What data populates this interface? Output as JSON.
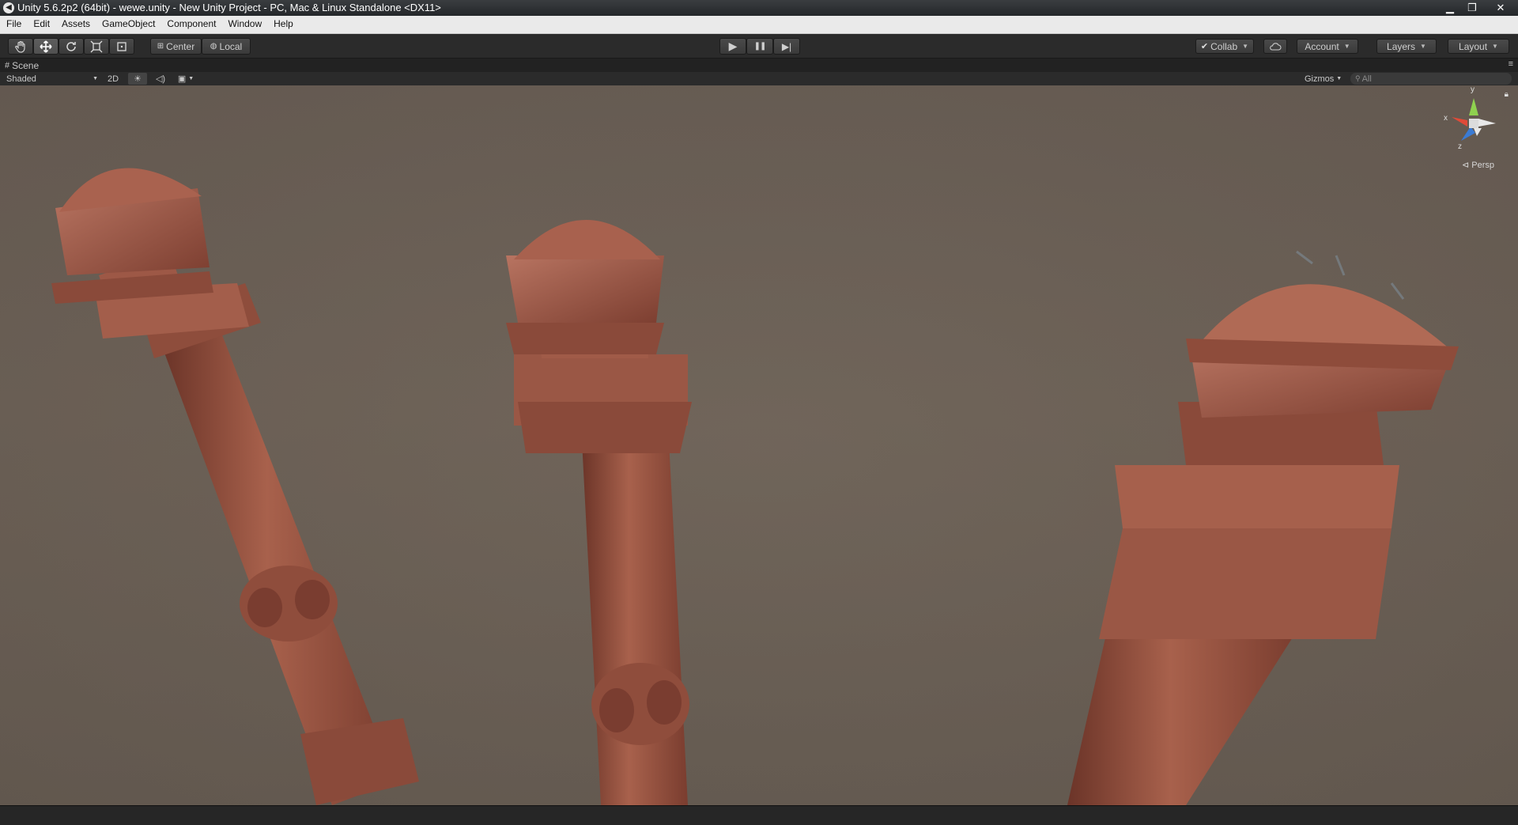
{
  "window": {
    "title": "Unity 5.6.2p2 (64bit) - wewe.unity - New Unity Project - PC, Mac & Linux Standalone <DX11>",
    "minimize_glyph": "▁",
    "maximize_glyph": "❐",
    "close_glyph": "✕"
  },
  "menu": [
    "File",
    "Edit",
    "Assets",
    "GameObject",
    "Component",
    "Window",
    "Help"
  ],
  "toolbar": {
    "tools": [
      "hand-tool",
      "move-tool",
      "rotate-tool",
      "scale-tool",
      "rect-tool"
    ],
    "active_tool": "move-tool",
    "pivot_label": "Center",
    "space_label": "Local",
    "play_glyph": "▶",
    "pause_glyph": "❚❚",
    "step_glyph": "▶|",
    "collab_label": "Collab",
    "account_label": "Account",
    "layers_label": "Layers",
    "layout_label": "Layout"
  },
  "scene_tab": {
    "label": "Scene"
  },
  "scene_bar": {
    "draw_mode": "Shaded",
    "mode_2d": "2D",
    "gizmos_label": "Gizmos",
    "search_placeholder": "All"
  },
  "gizmo": {
    "y": "y",
    "x": "x",
    "z": "z",
    "projection": "Persp"
  },
  "colors": {
    "viewport_bg": "#6b6057",
    "pillar": "#9a5a47",
    "toolbar": "#2b2b2b",
    "menubar": "#eaeaea"
  }
}
